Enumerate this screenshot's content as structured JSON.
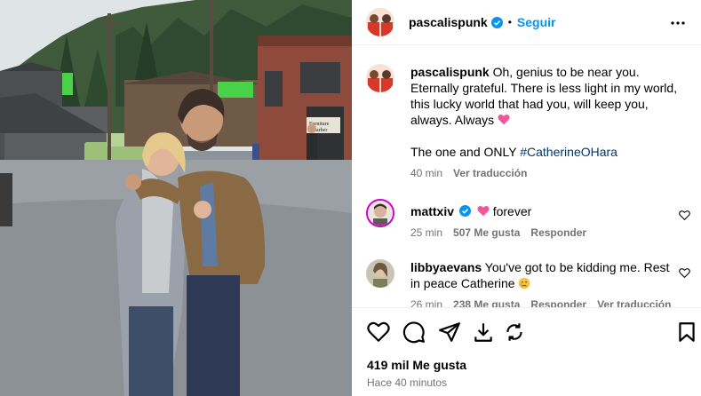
{
  "post": {
    "username": "pascalispunk",
    "follow_label": "Seguir",
    "separator": "•",
    "caption_line1": "Oh, genius to be near you.",
    "caption_line2": "Eternally grateful. There is less light in my world,",
    "caption_line3": "this lucky world that had you, will keep you,",
    "caption_line4": "always. Always",
    "caption_emoji": "heart",
    "caption_line5_prefix": "The one and ONLY ",
    "caption_hashtag": "#CatherineOHara",
    "caption_time": "40 min",
    "caption_translate": "Ver traducción"
  },
  "comments": [
    {
      "username": "mattxiv",
      "text": "forever",
      "emoji": "pink-heart",
      "time": "25 min",
      "likes": "507 Me gusta",
      "reply": "Responder"
    },
    {
      "username": "libbyaevans",
      "text_line1": "You've got to be kidding me. Rest",
      "text_line2": "in peace Catherine",
      "emoji": "crying-face",
      "time": "26 min",
      "likes": "238 Me gusta",
      "reply": "Responder",
      "translate": "Ver traducción"
    }
  ],
  "footer": {
    "likes": "419 mil Me gusta",
    "time_ago": "Hace 40 minutos"
  },
  "photo": {
    "scene": "Two people embracing on a small-town film set street",
    "sign_text_1": "Furniture",
    "sign_text_2": "Barber"
  },
  "colors": {
    "link": "#0095f6",
    "hashtag": "#00376b",
    "muted": "#737373",
    "heart": "#ff3040",
    "verified": "#0095f6"
  },
  "icons": [
    "more-icon",
    "heart-icon",
    "comment-icon",
    "share-icon",
    "repost-icon",
    "save-icon",
    "verified-icon"
  ]
}
